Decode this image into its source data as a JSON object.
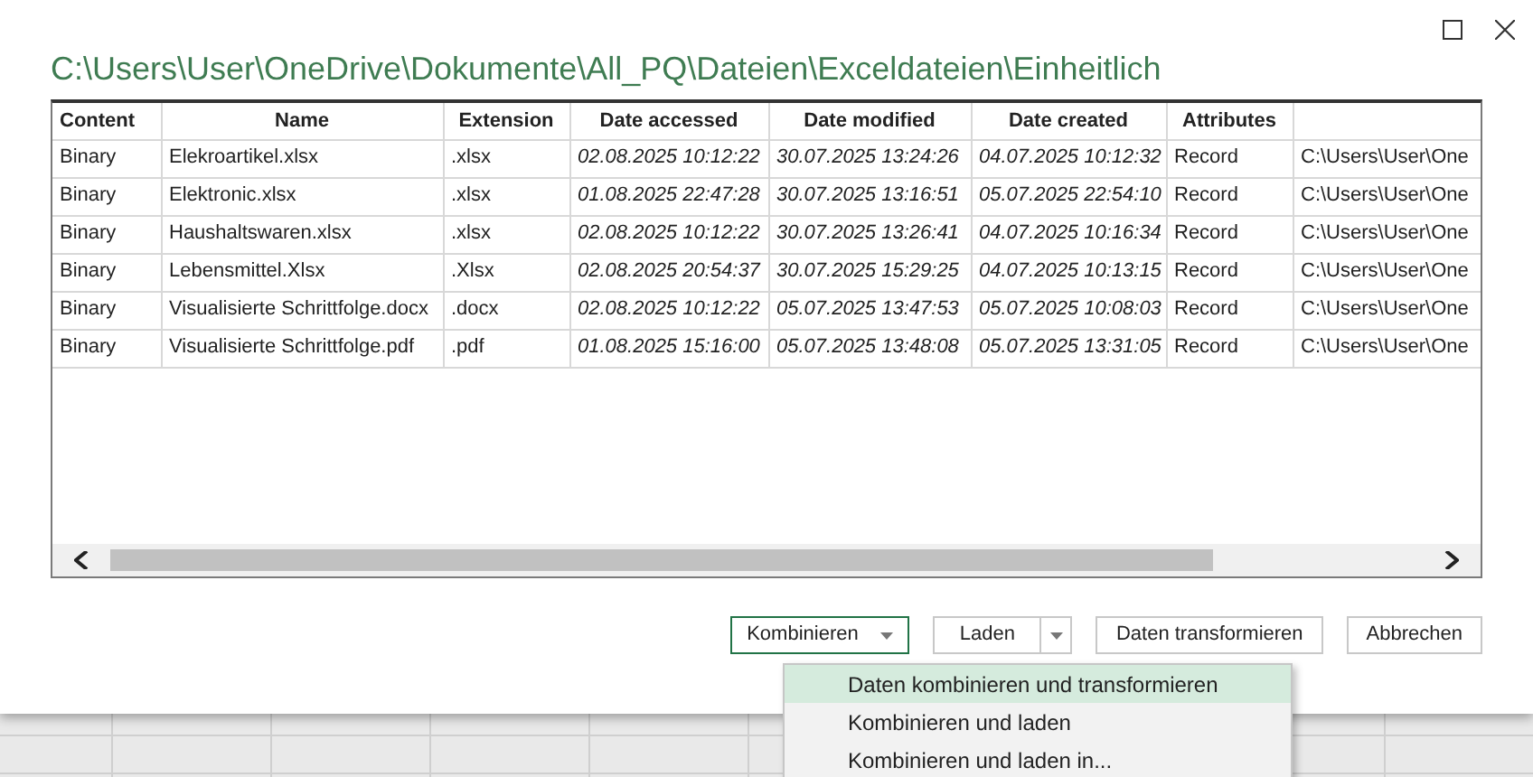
{
  "window": {
    "title": "C:\\Users\\User\\OneDrive\\Dokumente\\All_PQ\\Dateien\\Exceldateien\\Einheitlich"
  },
  "table": {
    "columns": [
      {
        "label": "Content",
        "kind": "text"
      },
      {
        "label": "Name",
        "kind": "text"
      },
      {
        "label": "Extension",
        "kind": "text"
      },
      {
        "label": "Date accessed",
        "kind": "date"
      },
      {
        "label": "Date modified",
        "kind": "date"
      },
      {
        "label": "Date created",
        "kind": "date"
      },
      {
        "label": "Attributes",
        "kind": "text"
      },
      {
        "kind": "text"
      }
    ],
    "rows": [
      {
        "cells": [
          "Binary",
          "Elekroartikel.xlsx",
          ".xlsx",
          "02.08.2025 10:12:22",
          "30.07.2025 13:24:26",
          "04.07.2025 10:12:32",
          "Record",
          "C:\\Users\\User\\One"
        ]
      },
      {
        "cells": [
          "Binary",
          "Elektronic.xlsx",
          ".xlsx",
          "01.08.2025 22:47:28",
          "30.07.2025 13:16:51",
          "05.07.2025 22:54:10",
          "Record",
          "C:\\Users\\User\\One"
        ]
      },
      {
        "cells": [
          "Binary",
          "Haushaltswaren.xlsx",
          ".xlsx",
          "02.08.2025 10:12:22",
          "30.07.2025 13:26:41",
          "04.07.2025 10:16:34",
          "Record",
          "C:\\Users\\User\\One"
        ]
      },
      {
        "cells": [
          "Binary",
          "Lebensmittel.Xlsx",
          ".Xlsx",
          "02.08.2025 20:54:37",
          "30.07.2025 15:29:25",
          "04.07.2025 10:13:15",
          "Record",
          "C:\\Users\\User\\One"
        ]
      },
      {
        "cells": [
          "Binary",
          "Visualisierte Schrittfolge.docx",
          ".docx",
          "02.08.2025 10:12:22",
          "05.07.2025 13:47:53",
          "05.07.2025 10:08:03",
          "Record",
          "C:\\Users\\User\\One"
        ]
      },
      {
        "cells": [
          "Binary",
          "Visualisierte Schrittfolge.pdf",
          ".pdf",
          "01.08.2025 15:16:00",
          "05.07.2025 13:48:08",
          "05.07.2025 13:31:05",
          "Record",
          "C:\\Users\\User\\One"
        ]
      }
    ]
  },
  "buttons": [
    {
      "label": "Kombinieren",
      "kind": "dropdown",
      "expanded": true
    },
    {
      "label": "Laden",
      "kind": "split",
      "expanded": false
    },
    {
      "label": "Daten transformieren",
      "kind": "plain",
      "expanded": false
    },
    {
      "label": "Abbrechen",
      "kind": "plain",
      "expanded": false
    }
  ],
  "menu": {
    "items": [
      {
        "label": "Daten kombinieren und transformieren",
        "selected": true
      },
      {
        "label": "Kombinieren und laden",
        "selected": false
      },
      {
        "label": "Kombinieren und laden in...",
        "selected": false
      }
    ]
  }
}
